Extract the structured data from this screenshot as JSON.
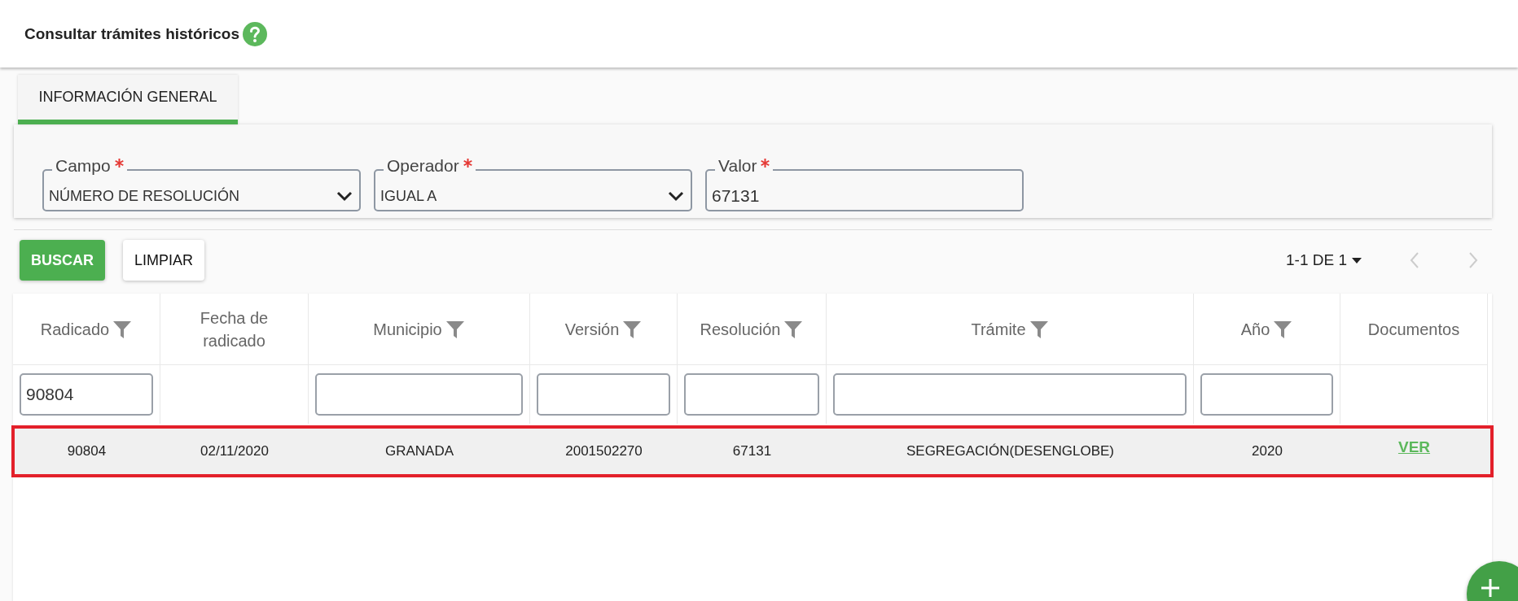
{
  "header": {
    "title": "Consultar trámites históricos"
  },
  "tabs": [
    {
      "label": "INFORMACIÓN GENERAL",
      "selected": true
    }
  ],
  "filters": [
    {
      "label": "Campo",
      "required": true,
      "kind": "select",
      "value": "NÚMERO DE RESOLUCIÓN"
    },
    {
      "label": "Operador",
      "required": true,
      "kind": "select",
      "value": "IGUAL A"
    },
    {
      "label": "Valor",
      "required": true,
      "kind": "text",
      "value": "67131"
    }
  ],
  "buttons": [
    {
      "label": "BUSCAR",
      "kind": "primary"
    },
    {
      "label": "LIMPIAR",
      "kind": "secondary"
    }
  ],
  "pagination": {
    "label": "1-1 DE 1"
  },
  "table": {
    "columns": [
      {
        "label": "Radicado",
        "filterable": true,
        "filter_value": "90804"
      },
      {
        "label": "Fecha de radicado",
        "filterable": false
      },
      {
        "label": "Municipio",
        "filterable": true
      },
      {
        "label": "Versión",
        "filterable": true
      },
      {
        "label": "Resolución",
        "filterable": true
      },
      {
        "label": "Trámite",
        "filterable": true
      },
      {
        "label": "Año",
        "filterable": true
      },
      {
        "label": "Documentos",
        "filterable": false
      }
    ],
    "rows": [
      {
        "cells": [
          "90804",
          "02/11/2020",
          "GRANADA",
          "2001502270",
          "67131",
          "SEGREGACIÓN(DESENGLOBE)",
          "2020"
        ],
        "link": "VER",
        "highlighted": true
      }
    ]
  }
}
